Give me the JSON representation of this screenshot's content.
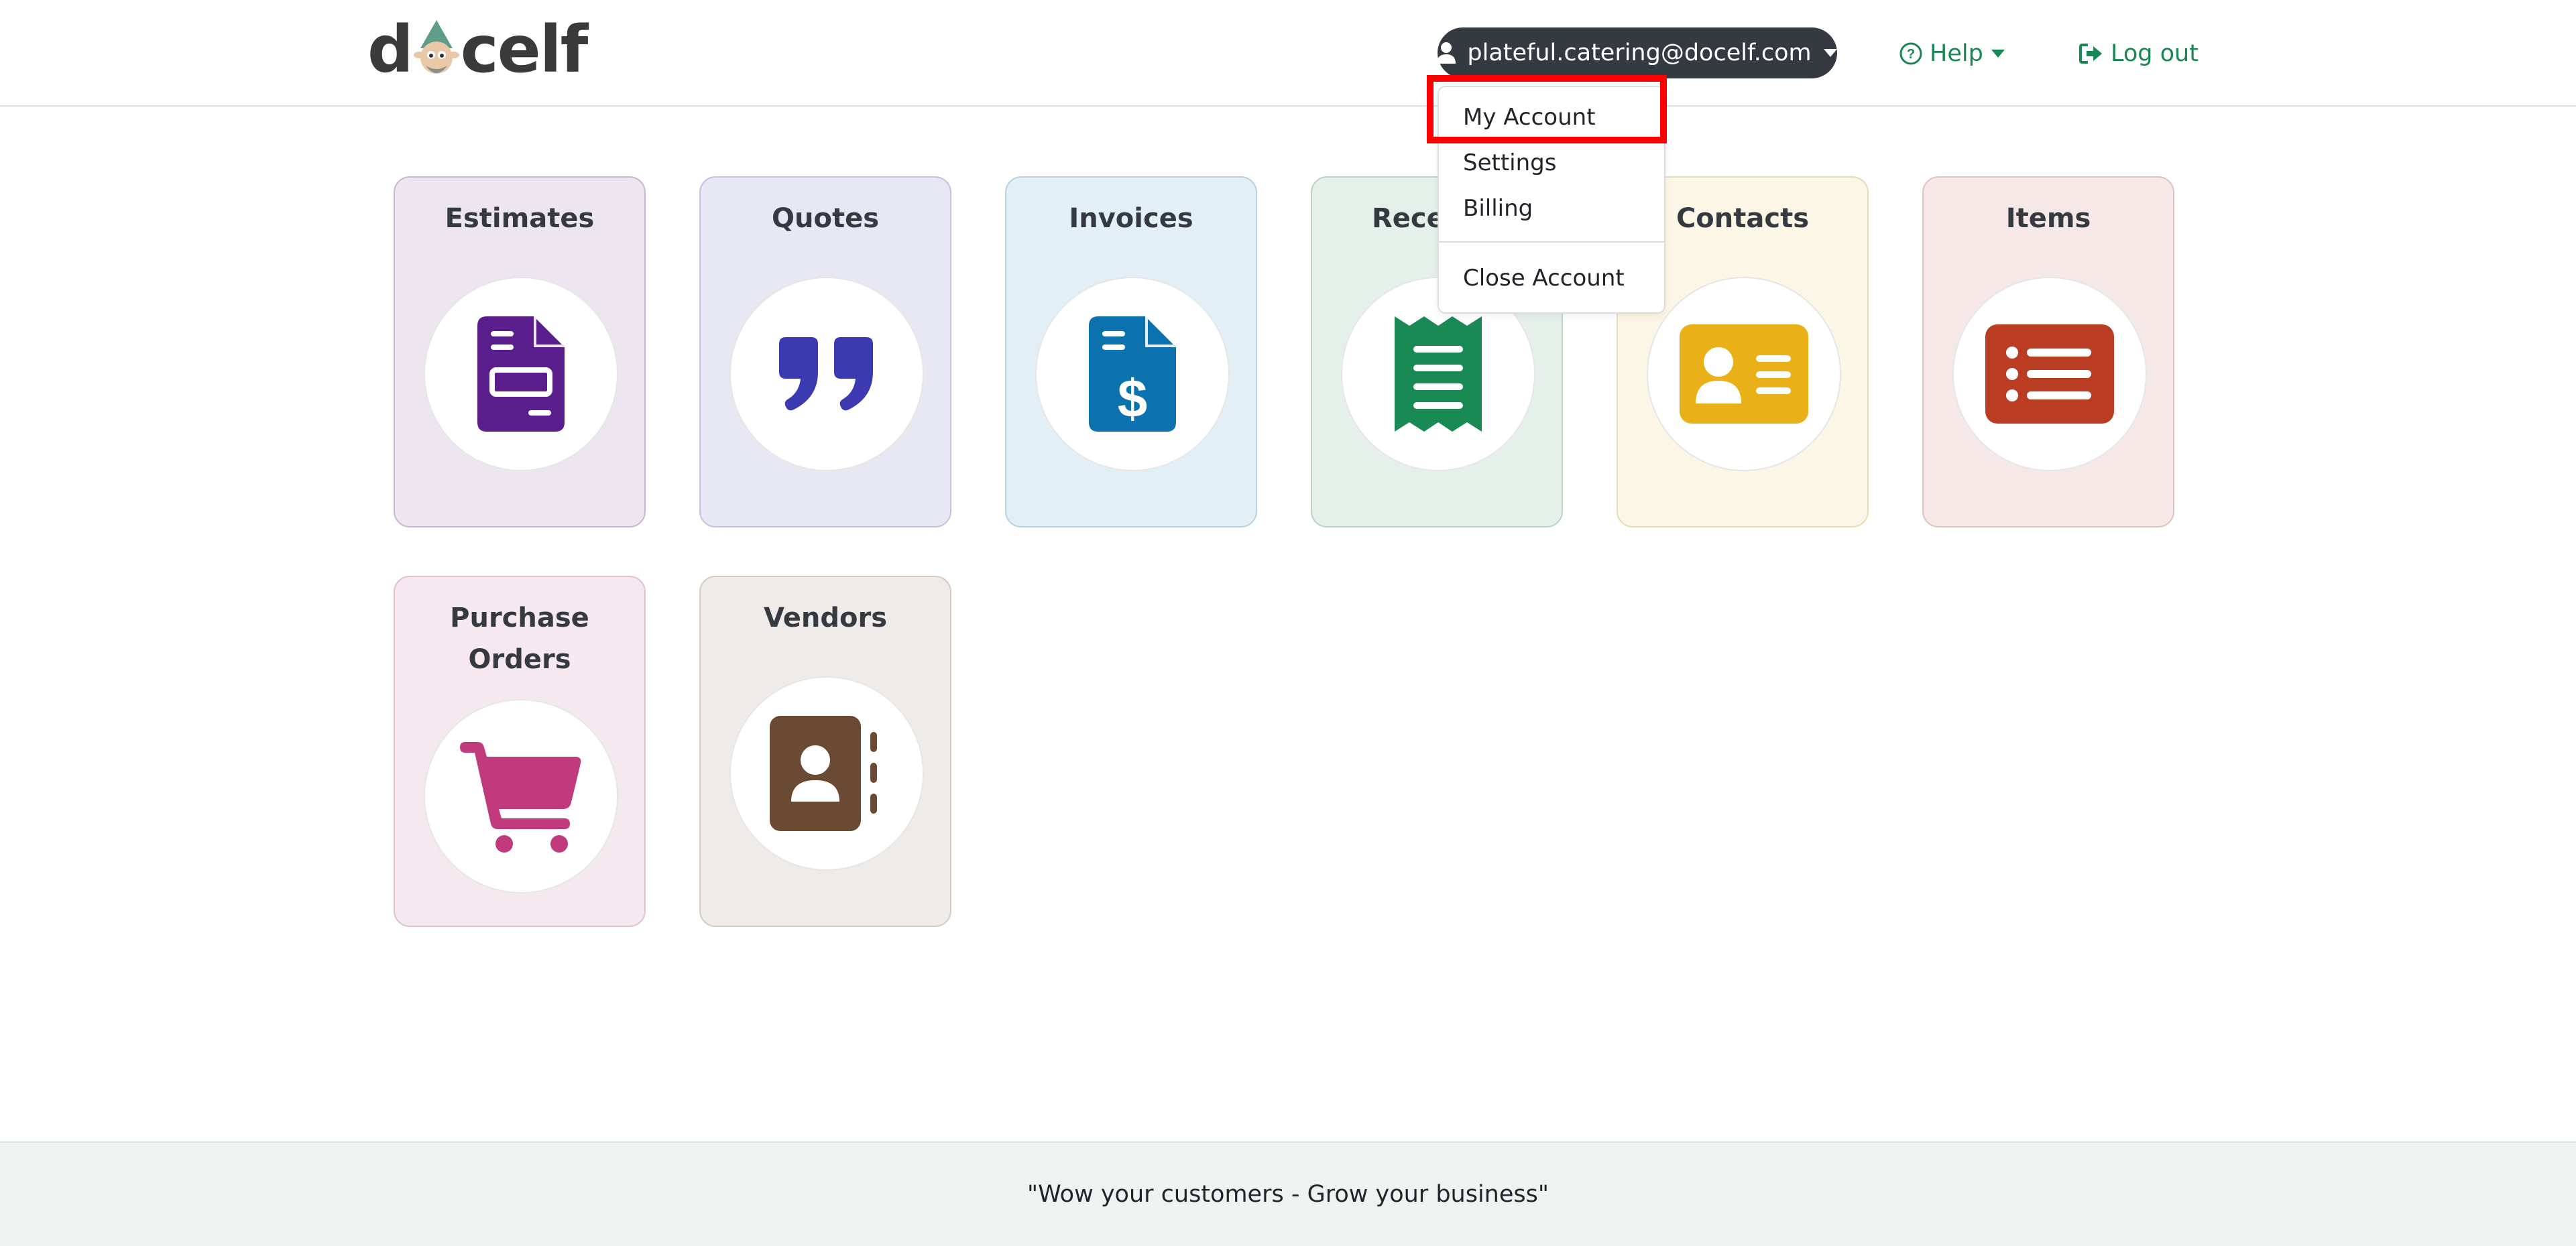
{
  "header": {
    "logo_text_left": "d",
    "logo_text_right": "celf",
    "account_email": "plateful.catering@docelf.com",
    "help_label": "Help",
    "logout_label": "Log out"
  },
  "account_menu": {
    "items": [
      "My Account",
      "Settings",
      "Billing"
    ],
    "danger_item": "Close Account",
    "highlighted_item": "My Account"
  },
  "tiles": [
    {
      "label": "Estimates",
      "icon": "file-invoice-icon",
      "color": "#5a1e8c",
      "bg": "#ede6f1",
      "border": "#c8b8d4"
    },
    {
      "label": "Quotes",
      "icon": "quote-icon",
      "color": "#3b3ab0",
      "bg": "#e8e7f4",
      "border": "#c5c3e0"
    },
    {
      "label": "Invoices",
      "icon": "file-dollar-icon",
      "color": "#0b72ae",
      "bg": "#e3eff6",
      "border": "#b9d2e2"
    },
    {
      "label": "Receipts",
      "icon": "receipt-icon",
      "color": "#1a8a55",
      "bg": "#e6f0ea",
      "border": "#bcd4c5"
    },
    {
      "label": "Contacts",
      "icon": "id-card-icon",
      "color": "#e9b018",
      "bg": "#fcf6e6",
      "border": "#e8dcb8"
    },
    {
      "label": "Items",
      "icon": "list-icon",
      "color": "#b93c23",
      "bg": "#f5e8e6",
      "border": "#e0c4bf"
    },
    {
      "label": "Purchase Orders",
      "icon": "cart-icon",
      "color": "#c23a7e",
      "bg": "#f6e8ef",
      "border": "#e2c1d2"
    },
    {
      "label": "Vendors",
      "icon": "address-book-icon",
      "color": "#6b4a33",
      "bg": "#efebe8",
      "border": "#d6ccc4"
    }
  ],
  "footer": {
    "tagline": "\"Wow your customers - Grow your business\""
  }
}
